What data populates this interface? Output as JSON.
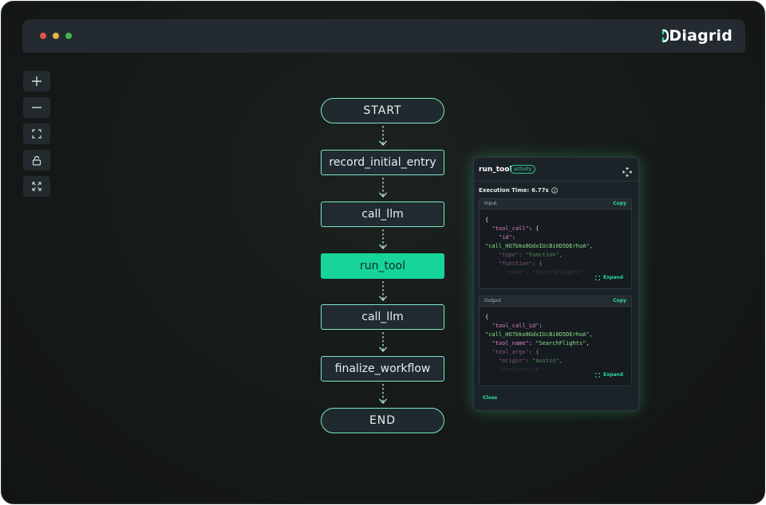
{
  "app": {
    "brand": "Diagrid",
    "window_dots": [
      "close",
      "minimize",
      "maximize"
    ]
  },
  "toolbar": {
    "items": [
      {
        "name": "zoom-in",
        "icon": "plus-icon"
      },
      {
        "name": "zoom-out",
        "icon": "minus-icon"
      },
      {
        "name": "fit-view",
        "icon": "fit-view-icon"
      },
      {
        "name": "lock",
        "icon": "lock-icon"
      },
      {
        "name": "fullscreen",
        "icon": "expand-icon"
      }
    ]
  },
  "workflow": {
    "nodes": [
      {
        "label": "START",
        "shape": "pill",
        "active": false
      },
      {
        "label": "record_initial_entry",
        "shape": "box",
        "active": false
      },
      {
        "label": "call_llm",
        "shape": "box",
        "active": false
      },
      {
        "label": "run_tool",
        "shape": "box",
        "active": true
      },
      {
        "label": "call_llm",
        "shape": "box",
        "active": false
      },
      {
        "label": "finalize_workflow",
        "shape": "box",
        "active": false
      },
      {
        "label": "END",
        "shape": "pill",
        "active": false
      }
    ]
  },
  "details_panel": {
    "title": "run_tool",
    "badge": "activity",
    "execution_label": "Execution Time:",
    "execution_value": "6.77s",
    "input": {
      "label": "Input",
      "copy_label": "Copy",
      "expand_label": "Expand",
      "lines": [
        {
          "t": "{",
          "c": "p",
          "f": 0
        },
        {
          "t": "  \"tool_call\": {",
          "c": "k",
          "f": 0
        },
        {
          "t": "    \"id\":",
          "c": "k",
          "f": 0
        },
        {
          "t": "\"call_HO7bko8GdxIUcBi0D5DErhoA\",",
          "c": "s",
          "f": 0
        },
        {
          "t": "    \"type\": \"function\",",
          "c": "k",
          "f": 1
        },
        {
          "t": "    \"function\": {",
          "c": "k",
          "f": 1
        },
        {
          "t": "      \"name\": \"SearchFlights\",",
          "c": "k",
          "f": 2
        }
      ]
    },
    "output": {
      "label": "Output",
      "copy_label": "Copy",
      "expand_label": "Expand",
      "lines": [
        {
          "t": "{",
          "c": "p",
          "f": 0
        },
        {
          "t": "  \"tool_call_id\":",
          "c": "k",
          "f": 0
        },
        {
          "t": "\"call_HO7bko8GdxIUcBi0D5DErhoA\",",
          "c": "s",
          "f": 0
        },
        {
          "t": "  \"tool_name\": \"SearchFlights\",",
          "c": "k",
          "f": 0
        },
        {
          "t": "  \"tool_args\": {",
          "c": "k",
          "f": 1
        },
        {
          "t": "    \"origin\": \"Austin\",",
          "c": "k",
          "f": 1
        },
        {
          "t": "    \"destination\":",
          "c": "k",
          "f": 2
        }
      ]
    },
    "close_label": "Close"
  },
  "colors": {
    "accent": "#17d49a",
    "node_border": "#7fe6c2",
    "background": "#151918"
  }
}
